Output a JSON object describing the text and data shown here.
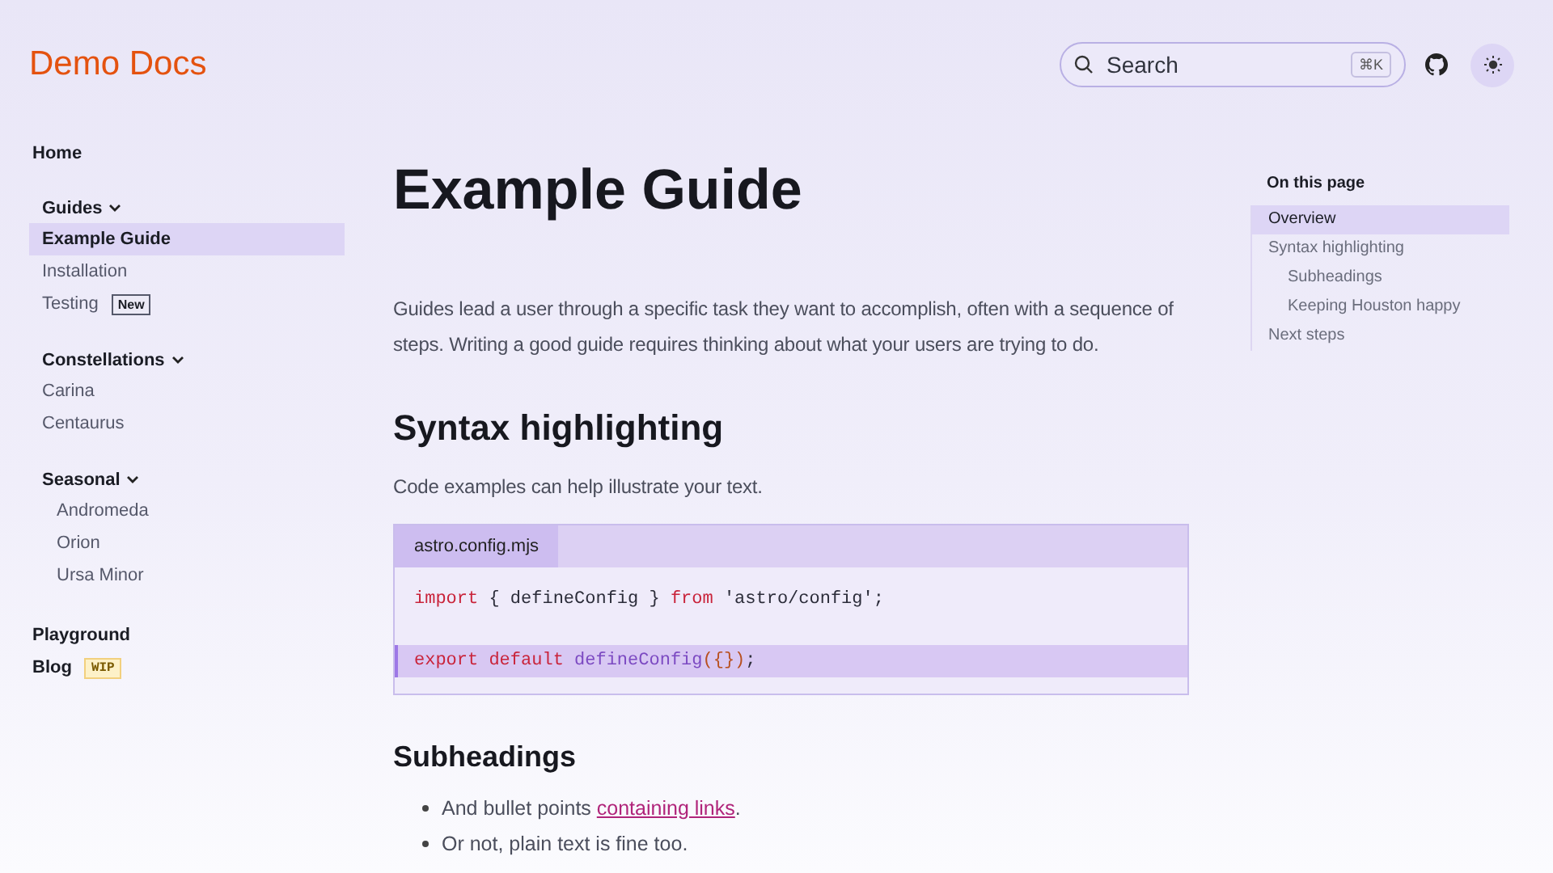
{
  "header": {
    "logo": "Demo Docs",
    "search": {
      "placeholder": "Search",
      "shortcut": "⌘K"
    }
  },
  "sidebar": {
    "items": [
      {
        "kind": "link",
        "label": "Home",
        "selected": false
      },
      {
        "kind": "group",
        "label": "Guides",
        "expanded": true,
        "children": [
          {
            "kind": "link",
            "label": "Example Guide",
            "selected": true
          },
          {
            "kind": "link",
            "label": "Installation",
            "selected": false
          },
          {
            "kind": "link",
            "label": "Testing",
            "selected": false,
            "badge": {
              "kind": "note",
              "text": "New"
            }
          }
        ]
      },
      {
        "kind": "group",
        "label": "Constellations",
        "expanded": true,
        "children": [
          {
            "kind": "link",
            "label": "Carina",
            "selected": false
          },
          {
            "kind": "link",
            "label": "Centaurus",
            "selected": false
          },
          {
            "kind": "group",
            "label": "Seasonal",
            "expanded": true,
            "children": [
              {
                "kind": "link",
                "label": "Andromeda",
                "selected": false
              },
              {
                "kind": "link",
                "label": "Orion",
                "selected": false
              },
              {
                "kind": "link",
                "label": "Ursa Minor",
                "selected": false
              }
            ]
          }
        ]
      },
      {
        "kind": "link",
        "label": "Playground",
        "selected": false
      },
      {
        "kind": "link",
        "label": "Blog",
        "selected": false,
        "badge": {
          "kind": "caution",
          "text": "WIP"
        }
      }
    ]
  },
  "content": {
    "title": "Example Guide",
    "intro": "Guides lead a user through a specific task they want to accomplish, often with a sequence of steps. Writing a good guide requires thinking about what your users are trying to do.",
    "sections": [
      {
        "heading": "Syntax highlighting",
        "text": "Code examples can help illustrate your text.",
        "code": {
          "filename": "astro.config.mjs",
          "lines": [
            {
              "marked": false,
              "tokens": [
                {
                  "kind": "keyword",
                  "text": "import"
                },
                {
                  "kind": "plain",
                  "text": " { defineConfig } "
                },
                {
                  "kind": "keyword",
                  "text": "from"
                },
                {
                  "kind": "plain",
                  "text": " 'astro/config';"
                }
              ]
            },
            {
              "marked": true,
              "tokens": [
                {
                  "kind": "keyword",
                  "text": "export default "
                },
                {
                  "kind": "function",
                  "text": "defineConfig"
                },
                {
                  "kind": "punct",
                  "text": "({})"
                },
                {
                  "kind": "plain",
                  "text": ";"
                }
              ]
            }
          ]
        }
      },
      {
        "heading": "Subheadings",
        "bullets": [
          {
            "text": "And bullet points ",
            "link": "containing links",
            "after": "."
          },
          {
            "text": "Or not, plain text is fine too."
          }
        ]
      }
    ]
  },
  "toc": {
    "title": "On this page",
    "items": [
      {
        "label": "Overview",
        "selected": true
      },
      {
        "label": "Syntax highlighting",
        "selected": false,
        "children": [
          {
            "label": "Subheadings",
            "selected": false
          },
          {
            "label": "Keeping Houston happy",
            "selected": false
          }
        ]
      },
      {
        "label": "Next steps",
        "selected": false
      }
    ]
  }
}
